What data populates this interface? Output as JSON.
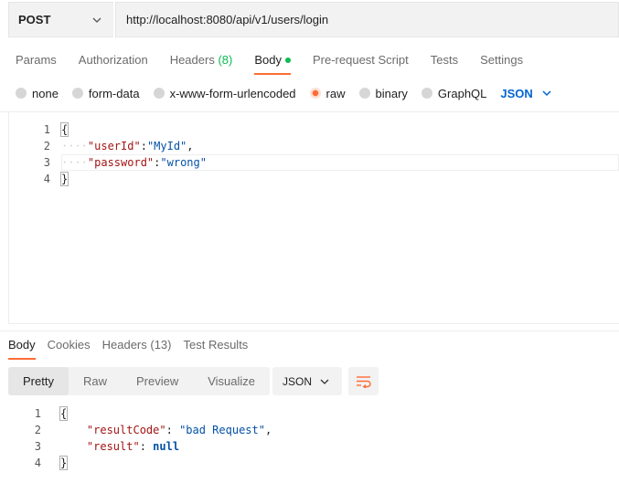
{
  "request": {
    "method": "POST",
    "url": "http://localhost:8080/api/v1/users/login"
  },
  "tabs": [
    {
      "label": "Params"
    },
    {
      "label": "Authorization"
    },
    {
      "label": "Headers",
      "count": "(8)"
    },
    {
      "label": "Body"
    },
    {
      "label": "Pre-request Script"
    },
    {
      "label": "Tests"
    },
    {
      "label": "Settings"
    }
  ],
  "body_types": [
    "none",
    "form-data",
    "x-www-form-urlencoded",
    "raw",
    "binary",
    "GraphQL"
  ],
  "body_language": "JSON",
  "request_body": {
    "line_numbers": [
      "1",
      "2",
      "3",
      "4"
    ],
    "open": "{",
    "close": "}",
    "key1": "\"userId\"",
    "val1": "\"MyId\"",
    "key2": "\"password\"",
    "val2": "\"wrong\"",
    "colon": ":",
    "comma": ",",
    "indent_dots": "····"
  },
  "response_tabs": [
    {
      "label": "Body"
    },
    {
      "label": "Cookies"
    },
    {
      "label": "Headers",
      "count": "(13)"
    },
    {
      "label": "Test Results"
    }
  ],
  "view_modes": [
    "Pretty",
    "Raw",
    "Preview",
    "Visualize"
  ],
  "response_format": "JSON",
  "response_body": {
    "line_numbers": [
      "1",
      "2",
      "3",
      "4"
    ],
    "open": "{",
    "close": "}",
    "key1": "\"resultCode\"",
    "val1": "\"bad Request\"",
    "key2": "\"result\"",
    "val2": "null",
    "colon_space": ": ",
    "comma": ","
  },
  "colors": {
    "accent": "#ff6c37",
    "indicator": "#0cbb52",
    "link_blue": "#0265d2"
  }
}
